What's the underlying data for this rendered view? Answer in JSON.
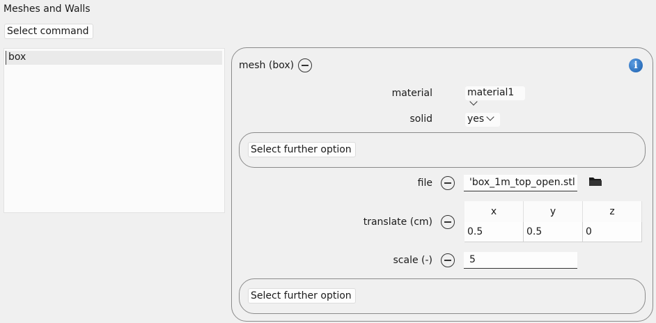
{
  "section_title": "Meshes and Walls",
  "select_command": "Select command",
  "list": {
    "items": [
      "box"
    ]
  },
  "mesh": {
    "header": "mesh (box)",
    "material": {
      "label": "material",
      "value": "material1"
    },
    "solid": {
      "label": "solid",
      "value": "yes"
    },
    "further_option_1": "Select further option",
    "file": {
      "label": "file",
      "value": "'box_1m_top_open.stl"
    },
    "translate": {
      "label": "translate (cm)",
      "headers": [
        "x",
        "y",
        "z"
      ],
      "values": [
        "0.5",
        "0.5",
        "0"
      ]
    },
    "scale": {
      "label": "scale (-)",
      "value": "5"
    },
    "further_option_2": "Select further option"
  },
  "icons": {
    "info": "info-icon",
    "remove": "minus-circle-icon",
    "folder": "folder-icon",
    "dropdown": "chevron-down-icon"
  }
}
